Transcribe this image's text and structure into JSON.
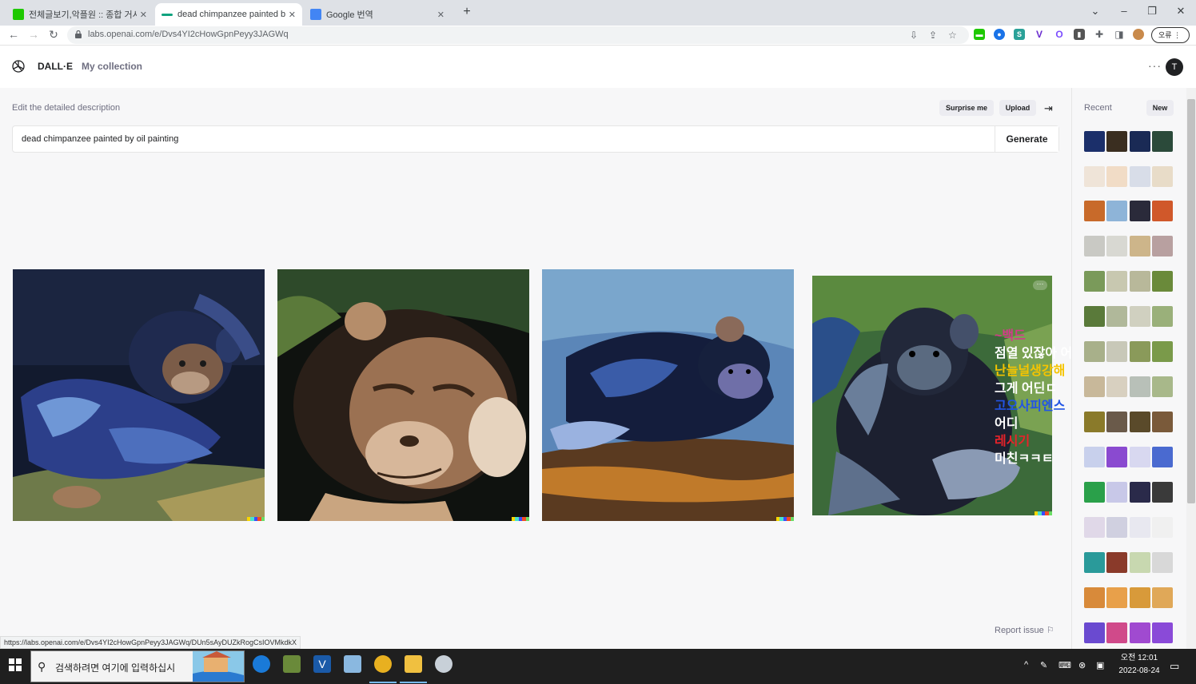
{
  "browser": {
    "tabs": [
      {
        "title": "전체글보기,악플원 :: 종합 거시기",
        "favicon_color": "#1ec800"
      },
      {
        "title": "dead chimpanzee painted by oil",
        "favicon_color": "#10a37f"
      },
      {
        "title": "Google 번역",
        "favicon_color": "#4285f4"
      }
    ],
    "url": "labs.openai.com/e/Dvs4YI2cHowGpnPeyy3JAGWq",
    "profile_label": "오류",
    "status_url": "https://labs.openai.com/e/Dvs4YI2cHowGpnPeyy3JAGWq/DUn5sAyDUZkRogCsIOVMkdkX"
  },
  "header": {
    "brand": "DALL·E",
    "collection": "My collection",
    "avatar_letter": "T"
  },
  "editor": {
    "label": "Edit the detailed description",
    "surprise_label": "Surprise me",
    "upload_label": "Upload",
    "prompt_value": "dead chimpanzee painted by oil painting",
    "generate_label": "Generate"
  },
  "results": [
    {
      "alt": "chimpanzee painting 1"
    },
    {
      "alt": "chimpanzee painting 2"
    },
    {
      "alt": "chimpanzee painting 3"
    },
    {
      "alt": "chimpanzee painting 4"
    }
  ],
  "overlay_lines": [
    {
      "text": "~백드",
      "color": "#d23a8a"
    },
    {
      "text": "점열 있잖아 어차피",
      "color": "#ffffff"
    },
    {
      "text": "난늘널생강해",
      "color": "#f5c400"
    },
    {
      "text": "그게 어딘ㄷ",
      "color": "#ffffff"
    },
    {
      "text": "고오사피엔스",
      "color": "#2255e6"
    },
    {
      "text": "어디",
      "color": "#ffffff"
    },
    {
      "text": "레시기",
      "color": "#e8232a"
    },
    {
      "text": "미친ㅋㅋㅌ",
      "color": "#ffffff"
    }
  ],
  "report_label": "Report issue",
  "sidebar": {
    "recent_label": "Recent",
    "new_label": "New"
  },
  "taskbar": {
    "search_placeholder": "검색하려면 여기에 입력하십시",
    "time": "오전 12:01",
    "date": "2022-08-24"
  }
}
